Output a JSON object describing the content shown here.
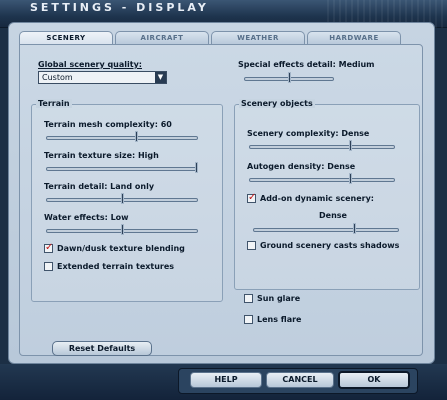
{
  "header": {
    "title": "SETTINGS - DISPLAY"
  },
  "tabs": [
    {
      "label": "SCENERY",
      "active": true
    },
    {
      "label": "AIRCRAFT"
    },
    {
      "label": "WEATHER"
    },
    {
      "label": "HARDWARE"
    }
  ],
  "global": {
    "label": "Global scenery quality:",
    "value": "Custom"
  },
  "special_effects": {
    "label": "Special effects detail: Medium",
    "level": 0.5
  },
  "terrain": {
    "title": "Terrain",
    "mesh": {
      "label": "Terrain mesh complexity: 60",
      "level": 0.6
    },
    "texture": {
      "label": "Terrain texture size: High",
      "level": 1.0
    },
    "detail": {
      "label": "Terrain detail: Land only",
      "level": 0.5
    },
    "water": {
      "label": "Water effects: Low",
      "level": 0.5
    },
    "dawn_dusk": {
      "label": "Dawn/dusk texture blending",
      "checked": true
    },
    "extended": {
      "label": "Extended terrain textures",
      "checked": false
    }
  },
  "scenery_objects": {
    "title": "Scenery objects",
    "complexity": {
      "label": "Scenery complexity: Dense",
      "level": 0.7
    },
    "autogen": {
      "label": "Autogen density: Dense",
      "level": 0.7
    },
    "addon": {
      "label": "Add-on dynamic scenery:",
      "checked": true
    },
    "addon_value": {
      "label": "Dense",
      "level": 0.7
    },
    "shadows": {
      "label": "Ground scenery casts shadows",
      "checked": false
    }
  },
  "sun_glare": {
    "label": "Sun glare",
    "checked": false
  },
  "lens_flare": {
    "label": "Lens flare",
    "checked": false
  },
  "reset_label": "Reset Defaults",
  "footer": {
    "help": "HELP",
    "cancel": "CANCEL",
    "ok": "OK"
  }
}
